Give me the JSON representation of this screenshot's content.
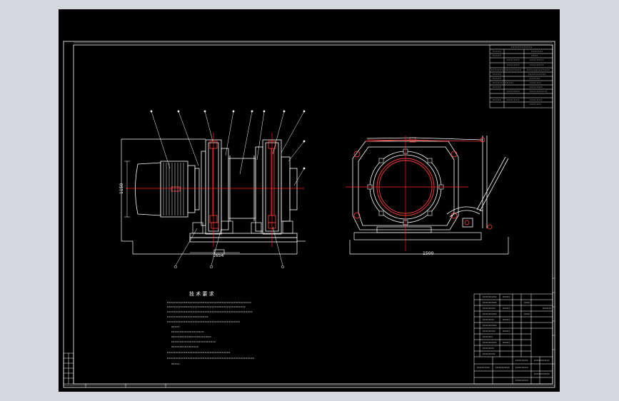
{
  "window": {
    "title": "A0",
    "background_color": "#d5d8dd",
    "drawing_background": "#000000"
  },
  "colors": {
    "line": "#ffffff",
    "center_line": "#ff2020",
    "accent": "#ff4040",
    "note_text": "#ffff66"
  },
  "dimensions": {
    "front_width": "1654",
    "front_height": "1150",
    "side_width": "1500"
  },
  "notes": {
    "title": "技 术 要 求"
  }
}
